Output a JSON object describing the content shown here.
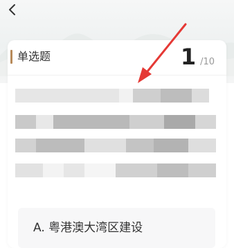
{
  "header": {
    "back_icon": "chevron-left-icon"
  },
  "question": {
    "type_label": "单选题",
    "progress_current": "1",
    "progress_total": "/10",
    "text_obscured": true
  },
  "options": [
    {
      "label": "A. 粤港澳大湾区建设"
    }
  ],
  "colors": {
    "accent_bar": "#b78a5a",
    "annotation_arrow": "#e53935"
  }
}
